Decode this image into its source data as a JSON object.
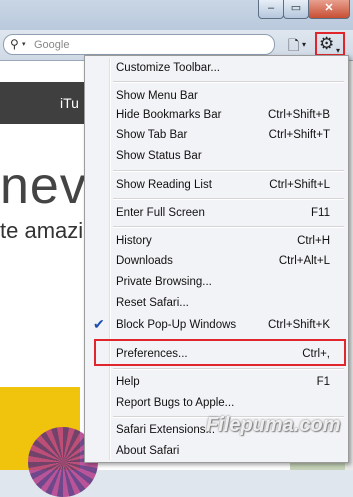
{
  "window": {
    "minimize_glyph": "–",
    "maximize_glyph": "▭",
    "close_glyph": "✕"
  },
  "toolbar": {
    "search_placeholder": "Google",
    "search_icon_glyph": "⚲",
    "dropdown_glyph": "▾",
    "page_icon_glyph": "🗋",
    "gear_icon_glyph": "⚙"
  },
  "page": {
    "nav_text": "iTu",
    "headline": "nev",
    "subline": "te amazin"
  },
  "menu": {
    "items": [
      {
        "label": "Customize Toolbar...",
        "shortcut": ""
      },
      {
        "label": "Show Menu Bar",
        "shortcut": ""
      },
      {
        "label": "Hide Bookmarks Bar",
        "shortcut": "Ctrl+Shift+B"
      },
      {
        "label": "Show Tab Bar",
        "shortcut": "Ctrl+Shift+T"
      },
      {
        "label": "Show Status Bar",
        "shortcut": ""
      },
      {
        "label": "Show Reading List",
        "shortcut": "Ctrl+Shift+L"
      },
      {
        "label": "Enter Full Screen",
        "shortcut": "F11"
      },
      {
        "label": "History",
        "shortcut": "Ctrl+H"
      },
      {
        "label": "Downloads",
        "shortcut": "Ctrl+Alt+L"
      },
      {
        "label": "Private Browsing...",
        "shortcut": ""
      },
      {
        "label": "Reset Safari...",
        "shortcut": ""
      },
      {
        "label": "Block Pop-Up Windows",
        "shortcut": "Ctrl+Shift+K",
        "checked": true,
        "check_glyph": "✔"
      },
      {
        "label": "Preferences...",
        "shortcut": "Ctrl+,"
      },
      {
        "label": "Help",
        "shortcut": "F1"
      },
      {
        "label": "Report Bugs to Apple...",
        "shortcut": ""
      },
      {
        "label": "Safari Extensions...",
        "shortcut": ""
      },
      {
        "label": "About Safari",
        "shortcut": ""
      }
    ]
  },
  "watermark": "Filepuma.com",
  "colors": {
    "highlight_box": "#e0262c",
    "menu_bg": "#f2f3f6",
    "check": "#1a4fb0"
  }
}
